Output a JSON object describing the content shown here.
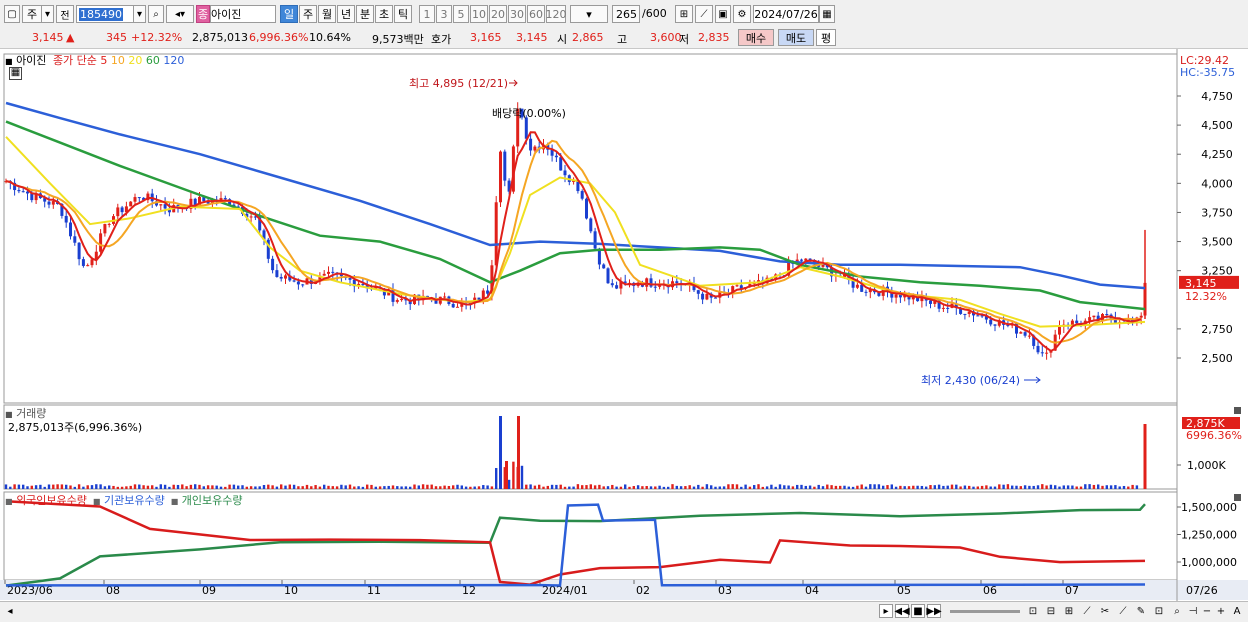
{
  "toolbar": {
    "market": "주",
    "period_prev": "전",
    "code": "185490",
    "badge": "종",
    "stock_name": "아이진",
    "periods": [
      "일",
      "주",
      "월",
      "년",
      "분",
      "초",
      "틱"
    ],
    "intervals": [
      "1",
      "3",
      "5",
      "10",
      "20",
      "30",
      "60",
      "120"
    ],
    "count": "265",
    "count_max": "/600",
    "date": "2024/07/26"
  },
  "quote": {
    "price": "3,145",
    "arrow": "▲",
    "change": "345",
    "change_pct": "+12.32%",
    "volume": "2,875,013",
    "vol_ratio": "6,996.36%",
    "turnover": "10.64%",
    "amount": "9,573백만",
    "hoga_label": "호가",
    "hoga1": "3,165",
    "hoga2": "3,145",
    "open_label": "시",
    "open": "2,865",
    "high_label": "고",
    "high": "3,600",
    "low_label": "저",
    "low": "2,835",
    "buy": "매수",
    "sell": "매도",
    "eval": "평"
  },
  "price_panel": {
    "name": "아이진",
    "legend_title": "종가 단순",
    "ma_periods": [
      "5",
      "10",
      "20",
      "60",
      "120"
    ],
    "ma_colors": [
      "#e0201a",
      "#f5a623",
      "#f0e020",
      "#2a9d3e",
      "#2c5fd8"
    ],
    "lc": "LC:29.42",
    "hc": "HC:-35.75",
    "y_ticks": [
      "4,750",
      "4,500",
      "4,250",
      "4,000",
      "3,750",
      "3,500",
      "3,250",
      "2,750",
      "2,500"
    ],
    "current_price_tag": "3,145",
    "current_pct_tag": "12.32%",
    "high_annotation": "최고 4,895 (12/21)",
    "low_annotation": "최저 2,430 (06/24)",
    "dividend_annotation": "배당락(0.00%)"
  },
  "volume_panel": {
    "title": "거래량",
    "value": "2,875,013주(6,996.36%)",
    "y_tick": "1,000K",
    "tag_value": "2,875K",
    "tag_pct": "6996.36%"
  },
  "holding_panel": {
    "series": [
      "외국인보유수량",
      "기관보유수량",
      "개인보유수량"
    ],
    "series_colors": [
      "#d81c1c",
      "#2c5fd8",
      "#2a8a4a"
    ],
    "y_ticks": [
      "1,500,000",
      "1,250,000",
      "1,000,000"
    ]
  },
  "x_axis": {
    "labels": [
      "2023/06",
      "08",
      "09",
      "10",
      "11",
      "12",
      "2024/01",
      "02",
      "03",
      "04",
      "05",
      "06",
      "07"
    ],
    "right_label": "07/26"
  }
}
